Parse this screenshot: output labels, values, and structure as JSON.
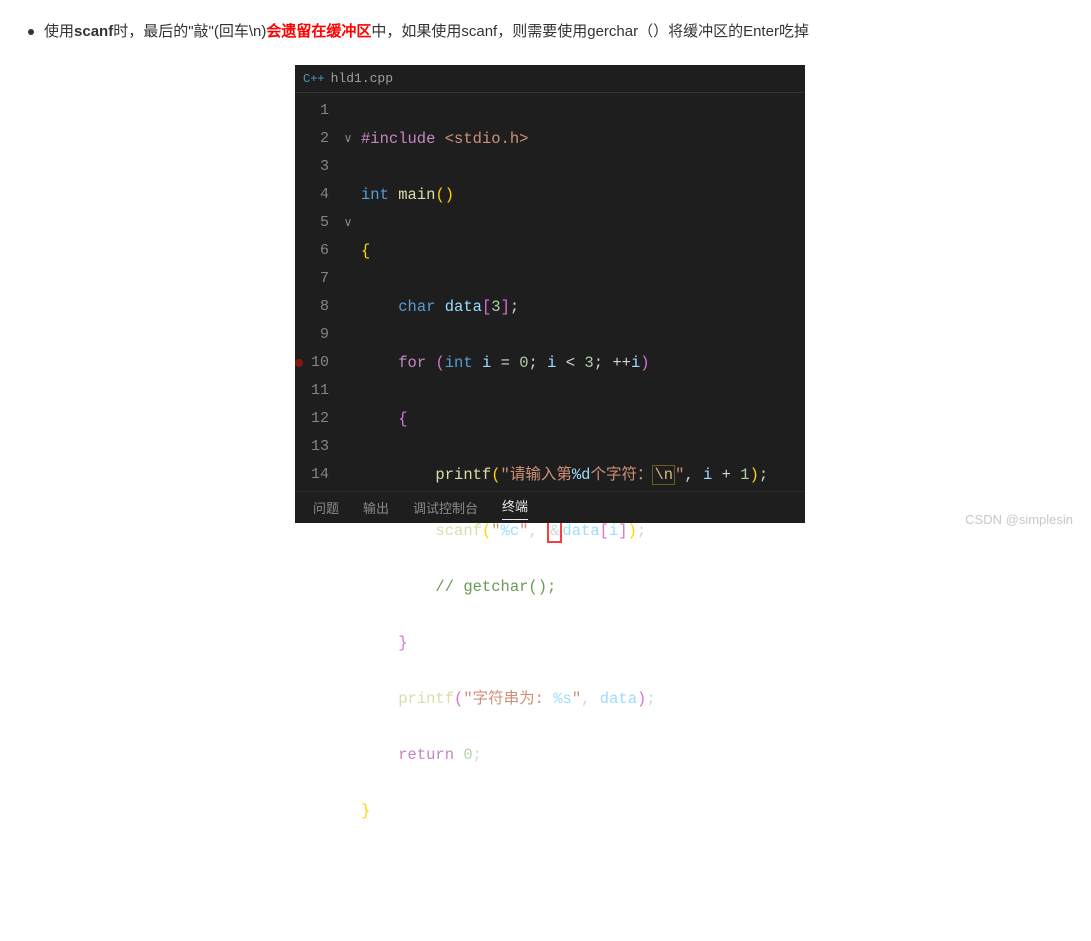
{
  "note": {
    "t1": "使用",
    "t2": "scanf",
    "t3": "时，最后的\"敲\"(回车\\n)",
    "t4": "会遗留在缓冲区",
    "t5": "中，如果使用scanf，则需要使用gerchar（）将缓冲区的Enter吃掉"
  },
  "editor": {
    "tab": {
      "lang": "C++",
      "filename": "hld1.cpp"
    },
    "lines": [
      "1",
      "2",
      "3",
      "4",
      "5",
      "6",
      "7",
      "8",
      "9",
      "10",
      "11",
      "12",
      "13",
      "14"
    ],
    "fold": {
      "l2": "∨",
      "l5": "∨"
    },
    "code": {
      "l1": {
        "include": "#include",
        "lib": "<stdio.h>"
      },
      "l2": {
        "type": "int",
        "fn": "main"
      },
      "l3": {
        "brace": "{"
      },
      "l4": {
        "type": "char",
        "var": "data",
        "size": "3"
      },
      "l5": {
        "for": "for",
        "int": "int",
        "i": "i",
        "zero": "0",
        "three": "3",
        "pp": "++"
      },
      "l6": {
        "brace": "{"
      },
      "l7": {
        "fn": "printf",
        "s1": "\"请输入第",
        "fmt": "%d",
        "s2": "个字符：",
        "esc": "\\n",
        "s3": "\"",
        "i": "i",
        "one": "1"
      },
      "l8": {
        "fn": "scanf",
        "s1": "\"",
        "fmt": "%c",
        "s2": "\"",
        "amp": "&",
        "var": "data",
        "i": "i"
      },
      "l9": {
        "comment": "// getchar();"
      },
      "l10": {
        "brace": "}"
      },
      "l11": {
        "fn": "printf",
        "s1": "\"字符串为: ",
        "fmt": "%s",
        "s2": "\"",
        "var": "data"
      },
      "l12": {
        "ret": "return",
        "zero": "0"
      },
      "l13": {
        "brace": "}"
      }
    },
    "panel": {
      "t1": "问题",
      "t2": "输出",
      "t3": "调试控制台",
      "t4": "终端"
    }
  },
  "watermark": "CSDN @simplesin"
}
